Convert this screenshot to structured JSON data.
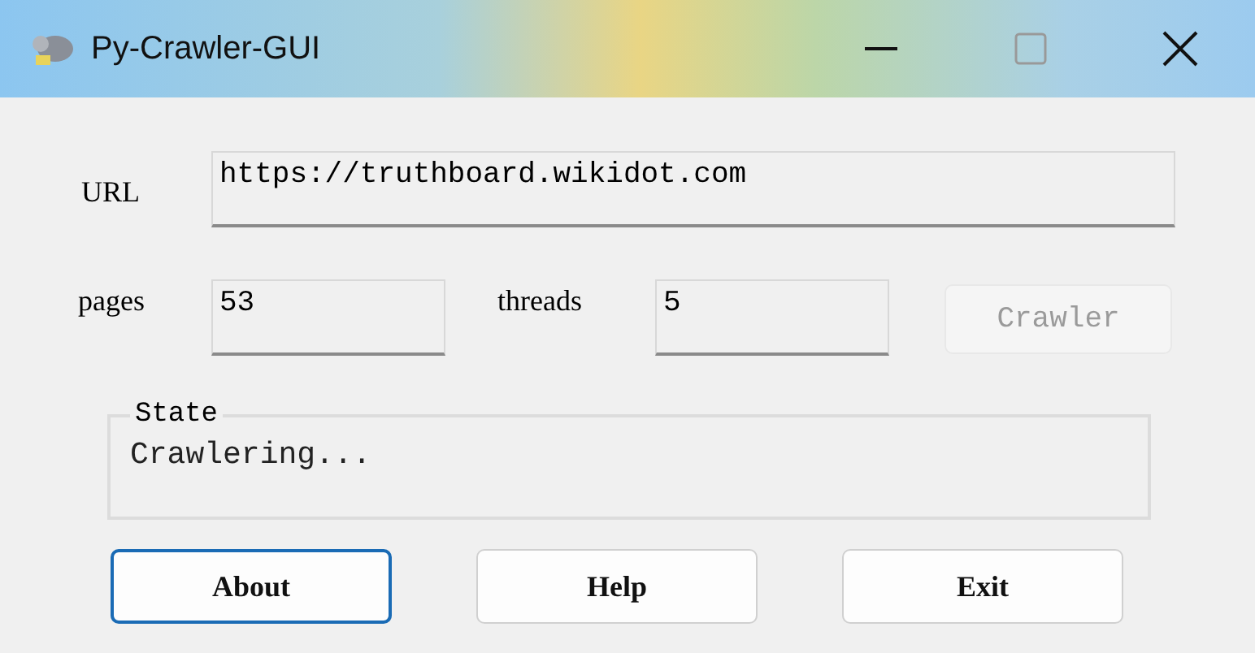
{
  "window": {
    "title": "Py-Crawler-GUI"
  },
  "url": {
    "label": "URL",
    "value": "https://truthboard.wikidot.com"
  },
  "pages": {
    "label": "pages",
    "value": "53"
  },
  "threads": {
    "label": "threads",
    "value": "5"
  },
  "crawl_button": {
    "label": "Crawler",
    "disabled": true
  },
  "state_group": {
    "legend": "State",
    "text": "Crawlering..."
  },
  "buttons": [
    {
      "label": "About",
      "focused": true
    },
    {
      "label": "Help",
      "focused": false
    },
    {
      "label": "Exit",
      "focused": false
    }
  ]
}
